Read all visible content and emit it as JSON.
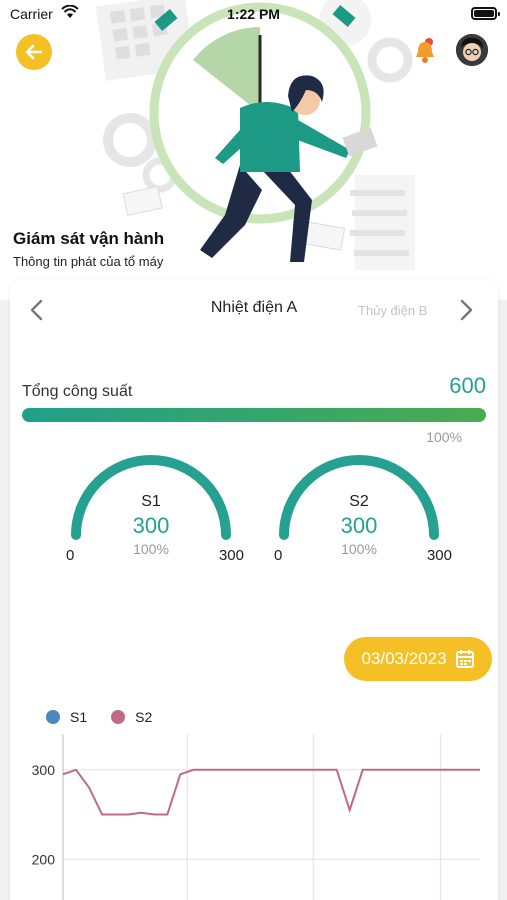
{
  "status_bar": {
    "carrier": "Carrier",
    "time": "1:22 PM"
  },
  "hero": {
    "title": "Giám sát vận hành",
    "subtitle": "Thông tin phát của tổ máy"
  },
  "icons": {
    "back": "arrow-left-icon",
    "notification": "bell-icon",
    "avatar": "user-avatar",
    "prev": "chevron-left-icon",
    "next": "chevron-right-icon",
    "calendar": "calendar-icon"
  },
  "tabs": {
    "current": "Nhiệt điện A",
    "next": "Thủy điện B"
  },
  "total": {
    "label": "Tổng công suất",
    "value": "600",
    "percent_label": "100%",
    "fill_fraction": 1.0
  },
  "gauges": [
    {
      "name": "S1",
      "value": "300",
      "percent": "100%",
      "min": "0",
      "max": "300",
      "fill_fraction": 1.0
    },
    {
      "name": "S2",
      "value": "300",
      "percent": "100%",
      "min": "0",
      "max": "300",
      "fill_fraction": 1.0
    }
  ],
  "date": "03/03/2023",
  "colors": {
    "accent_yellow": "#f5c025",
    "teal": "#26a191",
    "series_s1": "#4e86c0",
    "series_s2": "#c06a87"
  },
  "chart_data": {
    "type": "line",
    "legend": [
      "S1",
      "S2"
    ],
    "y_ticks": [
      "300",
      "200"
    ],
    "ylim": [
      150,
      340
    ],
    "x": [
      0,
      1,
      2,
      3,
      4,
      5,
      6,
      7,
      8,
      9,
      10,
      11,
      12,
      13,
      14,
      15,
      16,
      17,
      18,
      19,
      20,
      21,
      22,
      23,
      24,
      25,
      26,
      27,
      28,
      29,
      30,
      31,
      32
    ],
    "series": [
      {
        "name": "S2",
        "values": [
          295,
          300,
          280,
          250,
          250,
          250,
          252,
          250,
          250,
          295,
          300,
          300,
          300,
          300,
          300,
          300,
          300,
          300,
          300,
          300,
          300,
          300,
          255,
          300,
          300,
          300,
          300,
          300,
          300,
          300,
          300,
          300,
          300
        ]
      }
    ]
  }
}
